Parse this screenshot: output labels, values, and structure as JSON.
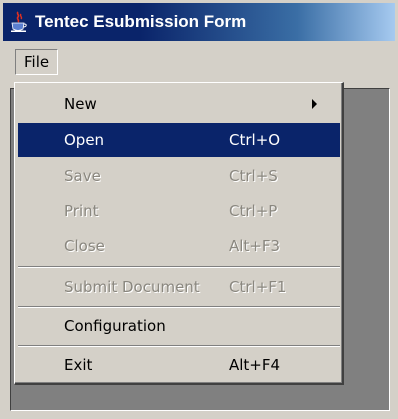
{
  "window": {
    "title": "Tentec Esubmission Form",
    "icon": "java-cup-icon"
  },
  "menubar": {
    "items": [
      {
        "label": "File"
      }
    ]
  },
  "file_menu": {
    "items": [
      {
        "label": "New",
        "shortcut": "",
        "submenu": true,
        "state": "normal"
      },
      {
        "label": "Open",
        "shortcut": "Ctrl+O",
        "state": "selected"
      },
      {
        "label": "Save",
        "shortcut": "Ctrl+S",
        "state": "disabled"
      },
      {
        "label": "Print",
        "shortcut": "Ctrl+P",
        "state": "disabled"
      },
      {
        "label": "Close",
        "shortcut": "Alt+F3",
        "state": "disabled"
      },
      {
        "label": "Submit Document",
        "shortcut": "Ctrl+F1",
        "state": "disabled"
      },
      {
        "label": "Configuration",
        "shortcut": "",
        "state": "normal"
      },
      {
        "label": "Exit",
        "shortcut": "Alt+F4",
        "state": "normal"
      }
    ]
  },
  "colors": {
    "selection": "#0a246a",
    "titlebar_start": "#0a246a",
    "titlebar_end": "#a6caf0",
    "face": "#d4d0c8",
    "workspace": "#808080",
    "disabled_text": "#8a877f"
  }
}
